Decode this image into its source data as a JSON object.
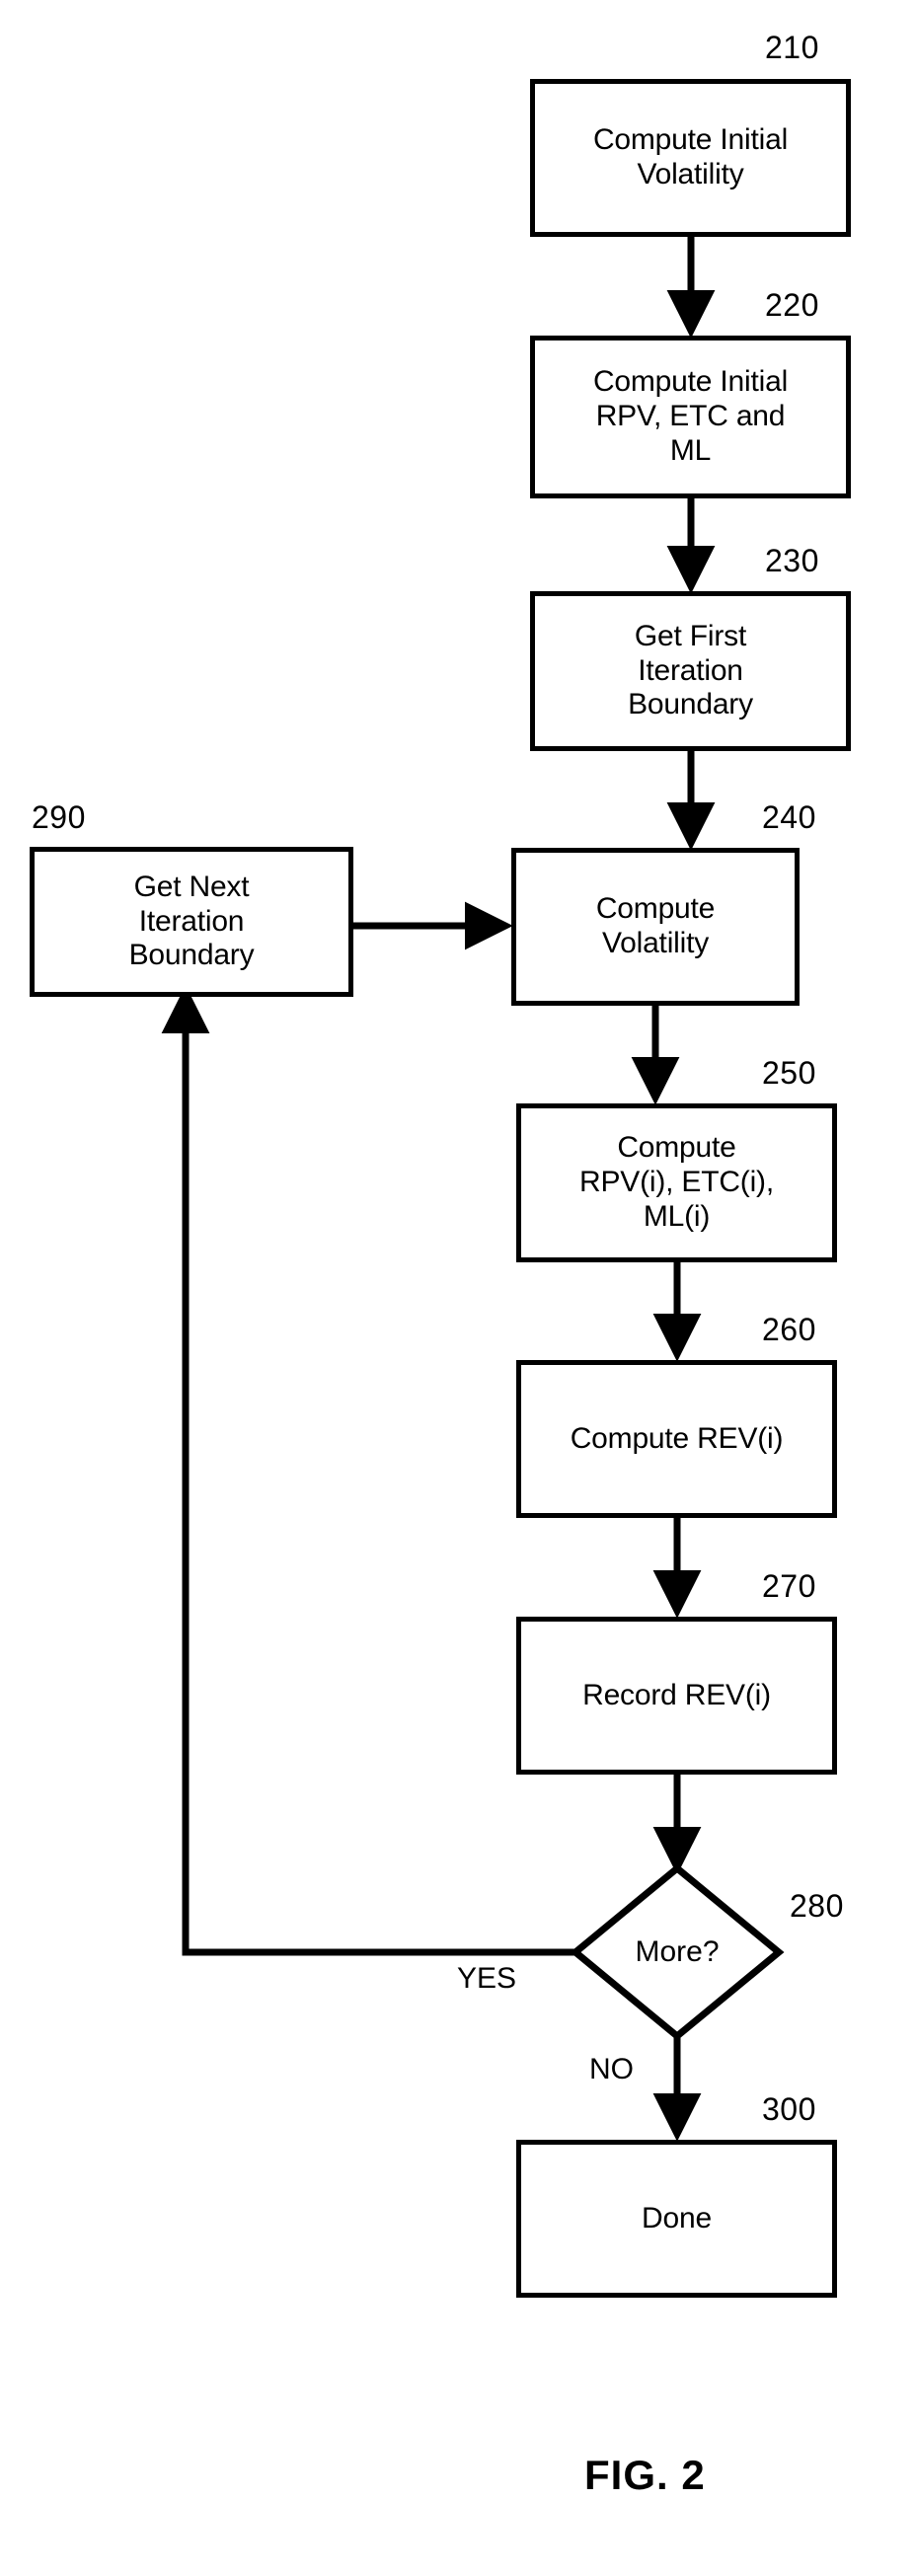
{
  "figure": {
    "caption": "FIG. 2"
  },
  "nodes": [
    {
      "id": "210",
      "ref": "210",
      "label": "Compute Initial\nVolatility",
      "shape": "process"
    },
    {
      "id": "220",
      "ref": "220",
      "label": "Compute Initial\nRPV, ETC and\nML",
      "shape": "process"
    },
    {
      "id": "230",
      "ref": "230",
      "label": "Get First\nIteration\nBoundary",
      "shape": "process"
    },
    {
      "id": "290",
      "ref": "290",
      "label": "Get Next\nIteration\nBoundary",
      "shape": "process"
    },
    {
      "id": "240",
      "ref": "240",
      "label": "Compute\nVolatility",
      "shape": "process"
    },
    {
      "id": "250",
      "ref": "250",
      "label": "Compute\nRPV(i), ETC(i),\nML(i)",
      "shape": "process"
    },
    {
      "id": "260",
      "ref": "260",
      "label": "Compute REV(i)",
      "shape": "process"
    },
    {
      "id": "270",
      "ref": "270",
      "label": "Record REV(i)",
      "shape": "process"
    },
    {
      "id": "280",
      "ref": "280",
      "label": "More?",
      "shape": "decision"
    },
    {
      "id": "300",
      "ref": "300",
      "label": "Done",
      "shape": "terminal"
    }
  ],
  "edge_labels": {
    "yes": "YES",
    "no": "NO"
  },
  "colors": {
    "stroke": "#000000",
    "fill": "#ffffff"
  }
}
